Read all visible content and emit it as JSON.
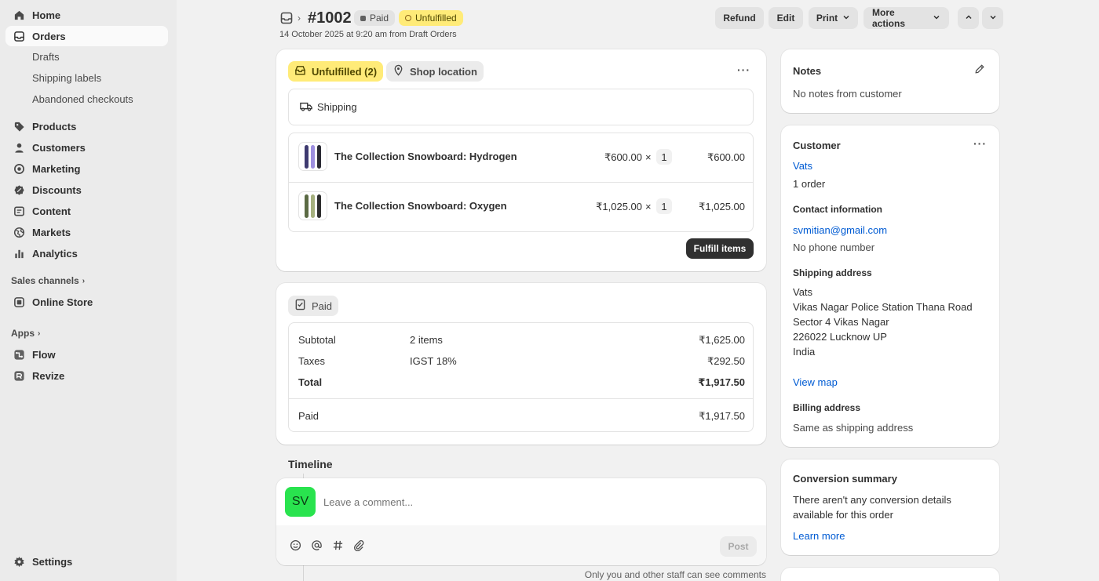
{
  "sidebar": {
    "items": [
      {
        "label": "Home",
        "icon": "home-icon"
      },
      {
        "label": "Orders",
        "icon": "orders-icon"
      },
      {
        "label": "Products",
        "icon": "tag-icon"
      },
      {
        "label": "Customers",
        "icon": "person-icon"
      },
      {
        "label": "Marketing",
        "icon": "target-icon"
      },
      {
        "label": "Discounts",
        "icon": "discount-icon"
      },
      {
        "label": "Content",
        "icon": "content-icon"
      },
      {
        "label": "Markets",
        "icon": "globe-icon"
      },
      {
        "label": "Analytics",
        "icon": "chart-bar-icon"
      }
    ],
    "orders_sub": [
      "Drafts",
      "Shipping labels",
      "Abandoned checkouts"
    ],
    "sales_channels_label": "Sales channels",
    "online_store": "Online Store",
    "apps_label": "Apps",
    "apps": [
      "Flow",
      "Revize"
    ],
    "settings": "Settings"
  },
  "header": {
    "order_number": "#1002",
    "paid_badge": "Paid",
    "unfulfilled_badge": "Unfulfilled",
    "date_line": "14 October 2025 at 9:20 am from Draft Orders",
    "buttons": {
      "refund": "Refund",
      "edit": "Edit",
      "print": "Print",
      "more": "More actions"
    }
  },
  "fulfillment": {
    "status_pill": "Unfulfilled (2)",
    "location_pill": "Shop location",
    "delivery_method": "Shipping",
    "items": [
      {
        "name": "The Collection Snowboard: Hydrogen",
        "price": "₹600.00",
        "times": "×",
        "qty": "1",
        "total": "₹600.00"
      },
      {
        "name": "The Collection Snowboard: Oxygen",
        "price": "₹1,025.00",
        "times": "×",
        "qty": "1",
        "total": "₹1,025.00"
      }
    ],
    "fulfill_button": "Fulfill items"
  },
  "payment": {
    "status_pill": "Paid",
    "subtotal_label": "Subtotal",
    "subtotal_desc": "2 items",
    "subtotal_value": "₹1,625.00",
    "taxes_label": "Taxes",
    "taxes_desc": "IGST 18%",
    "taxes_value": "₹292.50",
    "total_label": "Total",
    "total_value": "₹1,917.50",
    "paid_label": "Paid",
    "paid_value": "₹1,917.50"
  },
  "timeline": {
    "title": "Timeline",
    "avatar_initials": "SV",
    "avatar_color": "#29e34e",
    "comment_placeholder": "Leave a comment...",
    "post_button": "Post",
    "footer_note": "Only you and other staff can see comments"
  },
  "notes": {
    "title": "Notes",
    "text": "No notes from customer"
  },
  "customer": {
    "title": "Customer",
    "name": "Vats",
    "orders": "1 order",
    "contact_title": "Contact information",
    "email": "svmitian@gmail.com",
    "phone": "No phone number",
    "shipping_title": "Shipping address",
    "address_lines": [
      "Vats",
      "Vikas Nagar Police Station Thana Road",
      "Sector 4 Vikas Nagar",
      "226022 Lucknow UP",
      "India"
    ],
    "view_map": "View map",
    "billing_title": "Billing address",
    "billing_text": "Same as shipping address"
  },
  "conversion": {
    "title": "Conversion summary",
    "line1": "There aren't any conversion details",
    "line2": "available for this order",
    "learn_more": "Learn more"
  },
  "colors": {
    "link": "#005bd3",
    "unfulfilled_bg": "#ffeb78",
    "primary_button": "#303030"
  }
}
